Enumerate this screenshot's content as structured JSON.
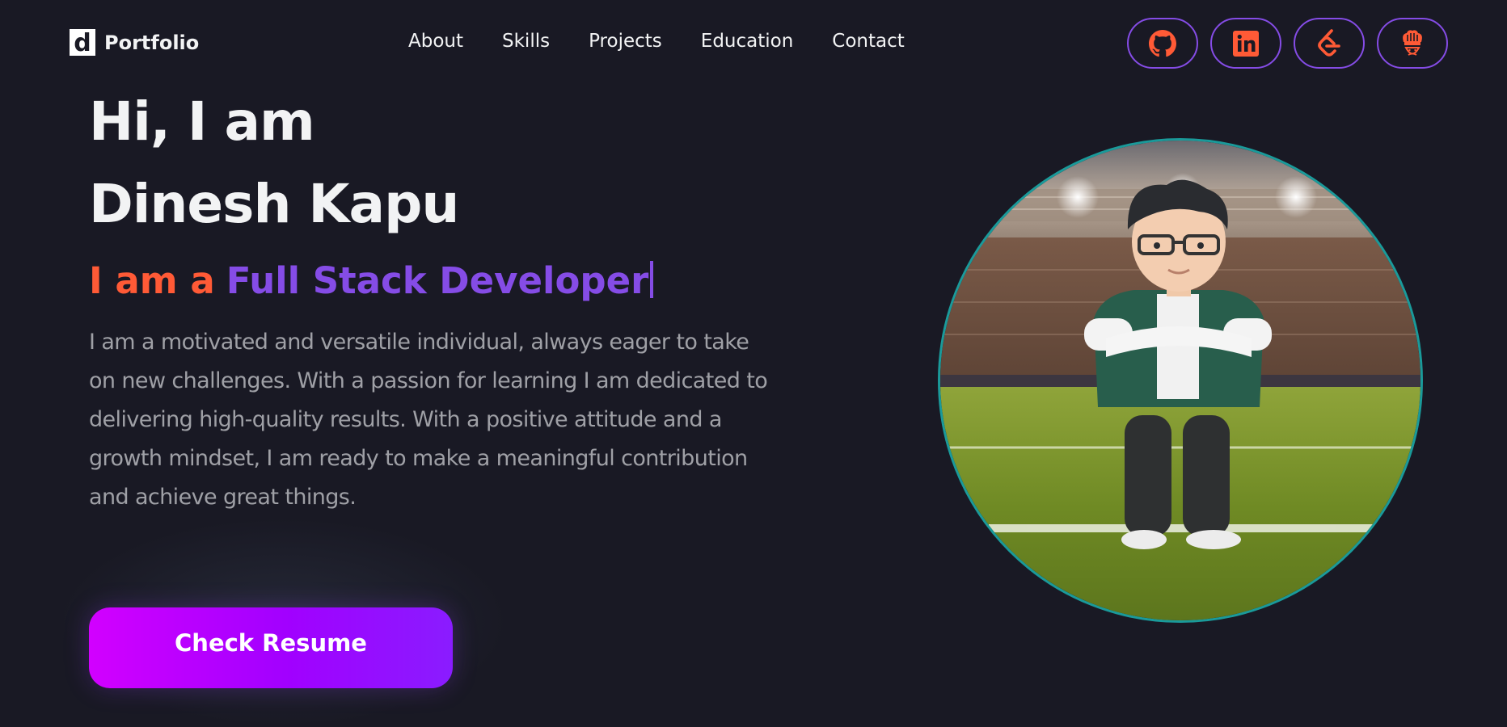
{
  "navbar": {
    "logo_letter": "d",
    "logo_text": "Portfolio",
    "links": [
      {
        "label": "About"
      },
      {
        "label": "Skills"
      },
      {
        "label": "Projects"
      },
      {
        "label": "Education"
      },
      {
        "label": "Contact"
      }
    ],
    "social": [
      {
        "icon": "github-icon"
      },
      {
        "icon": "linkedin-icon"
      },
      {
        "icon": "leetcode-icon"
      },
      {
        "icon": "codechef-icon"
      }
    ]
  },
  "hero": {
    "title_line1": "Hi, I am",
    "title_line2": "Dinesh Kapu",
    "role_prefix": "I am a",
    "role_value": "Full Stack Developer",
    "description": "I am a motivated and versatile individual, always eager to take on new challenges. With a passion for learning I am dedicated to delivering high-quality results. With a positive attitude and a growth mindset, I am ready to make a meaningful contribution and achieve great things.",
    "cta_label": "Check Resume"
  },
  "avatar": {
    "icon": "avatar-stadium-image"
  },
  "colors": {
    "background": "#191924",
    "text_primary": "#f2f3f4",
    "text_secondary": "#9fa0a6",
    "accent_purple": "#854ce6",
    "accent_orange": "#ff5a36",
    "button_gradient_start": "#d200ff",
    "button_gradient_end": "#8a1cff",
    "avatar_border": "#1a9a9a"
  }
}
